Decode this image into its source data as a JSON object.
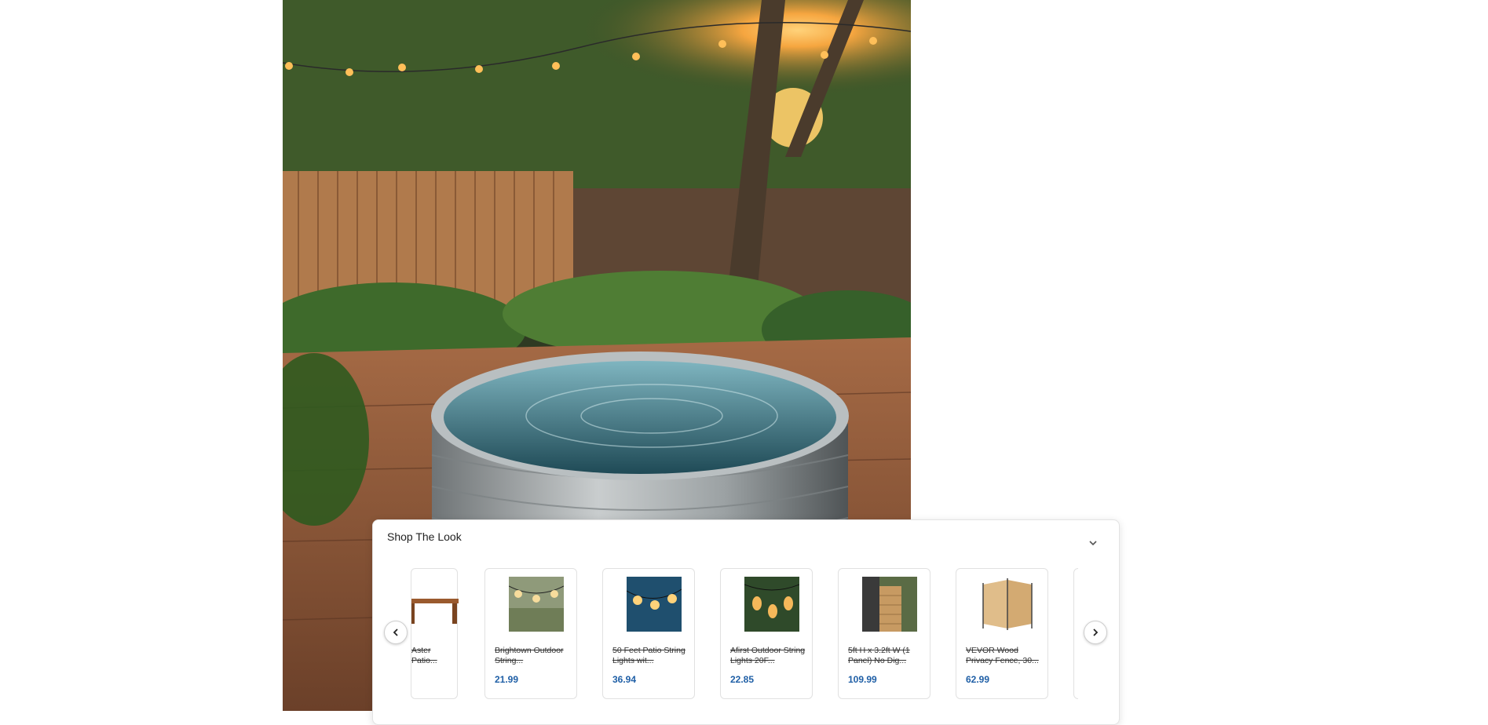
{
  "hero": {
    "icon": "backyard-stock-tank-pool-photo"
  },
  "shop_the_look": {
    "title": "Shop The Look",
    "collapse_icon": "chevron-down-icon",
    "prev_icon": "chevron-left-icon",
    "next_icon": "chevron-right-icon",
    "products": [
      {
        "title": "Aster Patio...",
        "price": "",
        "icon": "wood-bench-thumbnail"
      },
      {
        "title": "Brightown Outdoor String...",
        "price": "21.99",
        "icon": "string-lights-thumbnail"
      },
      {
        "title": "50 Feet Patio String Lights wit...",
        "price": "36.94",
        "icon": "string-lights-blue-thumbnail"
      },
      {
        "title": "Afirst Outdoor String Lights 20F...",
        "price": "22.85",
        "icon": "string-lights-bulbs-thumbnail"
      },
      {
        "title": "5ft H x 3.2ft W (1 Panel) No Dig...",
        "price": "109.99",
        "icon": "fence-panel-thumbnail"
      },
      {
        "title": "VEVOR Wood Privacy Fence, 30...",
        "price": "62.99",
        "icon": "privacy-screen-thumbnail"
      }
    ]
  }
}
